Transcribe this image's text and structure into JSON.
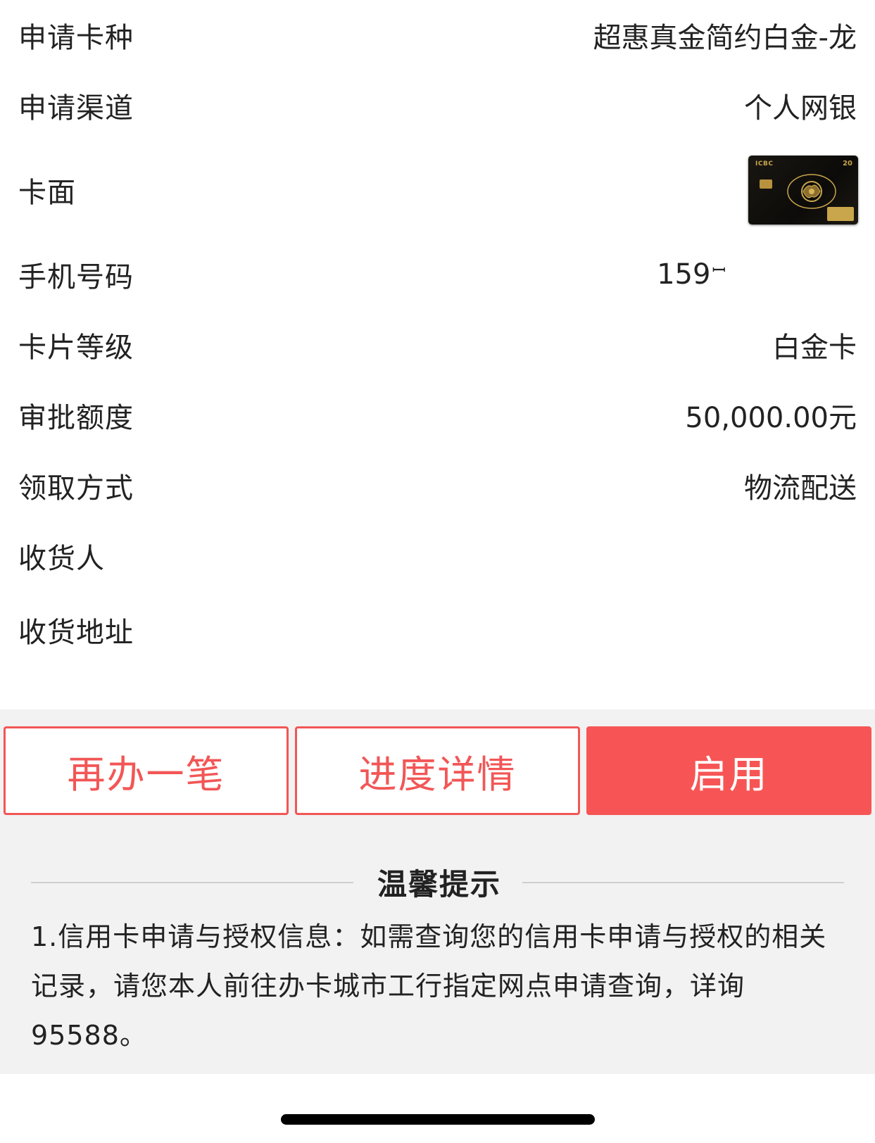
{
  "details": {
    "card_type": {
      "label": "申请卡种",
      "value": "超惠真金简约白金-龙"
    },
    "channel": {
      "label": "申请渠道",
      "value": "个人网银"
    },
    "card_face": {
      "label": "卡面",
      "logo_text": "ICBC",
      "badge_text": "20"
    },
    "phone": {
      "label": "手机号码",
      "value": "159"
    },
    "card_level": {
      "label": "卡片等级",
      "value": "白金卡"
    },
    "credit_limit": {
      "label": "审批额度",
      "value": "50,000.00元"
    },
    "pickup_method": {
      "label": "领取方式",
      "value": "物流配送"
    },
    "recipient": {
      "label": "收货人",
      "value": ""
    },
    "address": {
      "label": "收货地址",
      "value": ""
    }
  },
  "actions": {
    "apply_again": "再办一笔",
    "progress_details": "进度详情",
    "activate": "启用"
  },
  "tips": {
    "title": "温馨提示",
    "text": "1.信用卡申请与授权信息：如需查询您的信用卡申请与授权的相关记录，请您本人前往办卡城市工行指定网点申请查询，详询95588。"
  },
  "colors": {
    "accent": "#f75555",
    "outline_text": "#f25656",
    "grey_bg": "#f2f2f2"
  }
}
